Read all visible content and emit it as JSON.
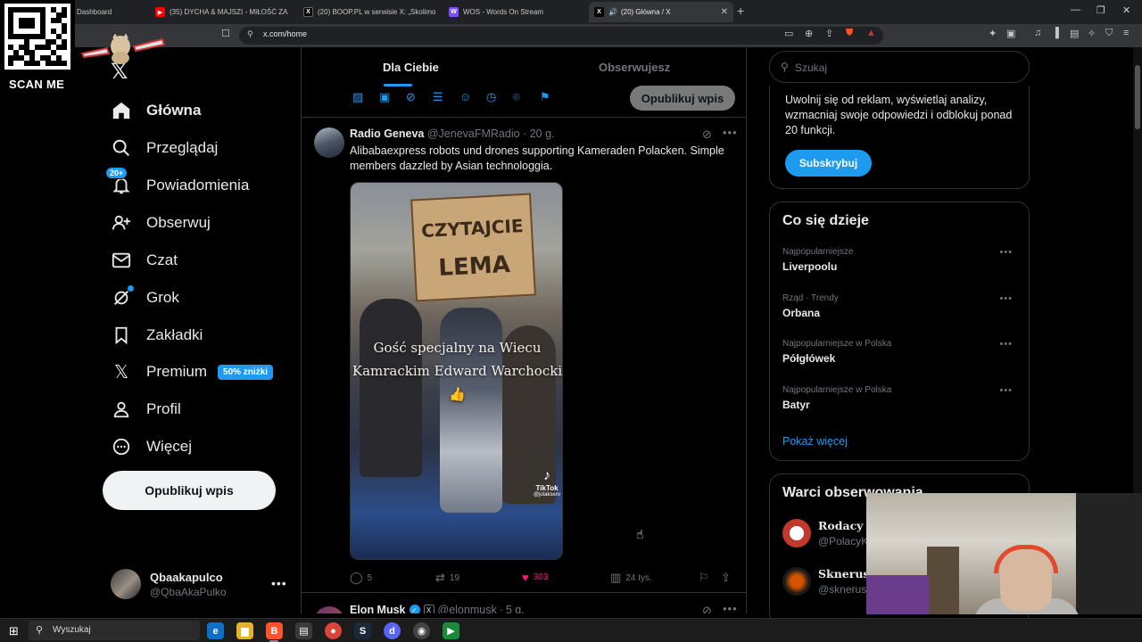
{
  "browser": {
    "tabs": [
      {
        "label": "Dashboard",
        "icon": "dashboard-icon",
        "active": false
      },
      {
        "label": "(35) DYCHA & MAJSZI - MIŁOŚĆ ZA",
        "icon": "youtube-icon",
        "active": false
      },
      {
        "label": "(20) BOOP.PL w serwisie X: „Skolimo",
        "icon": "x-icon",
        "active": false
      },
      {
        "label": "WOS - Words On Stream",
        "icon": "wos-icon",
        "active": false
      },
      {
        "label": "(20) Główna / X",
        "icon": "x-icon",
        "active": true
      }
    ],
    "url": "x.com/home"
  },
  "overlay": {
    "scan_me": "SCAN ME"
  },
  "sidebar": {
    "items": [
      {
        "label": "Główna",
        "icon": "home-icon",
        "active": true
      },
      {
        "label": "Przeglądaj",
        "icon": "search-icon"
      },
      {
        "label": "Powiadomienia",
        "icon": "bell-icon",
        "badge": "20+"
      },
      {
        "label": "Obserwuj",
        "icon": "follow-icon"
      },
      {
        "label": "Czat",
        "icon": "mail-icon"
      },
      {
        "label": "Grok",
        "icon": "grok-icon"
      },
      {
        "label": "Zakładki",
        "icon": "bookmark-icon"
      },
      {
        "label": "Premium",
        "icon": "x-logo-icon",
        "badge": "50% zniżki"
      },
      {
        "label": "Profil",
        "icon": "person-icon"
      },
      {
        "label": "Więcej",
        "icon": "more-circle-icon"
      }
    ],
    "post_button": "Opublikuj wpis",
    "account": {
      "name": "Qbaakapulco",
      "handle": "@QbaAkaPulko"
    }
  },
  "feed": {
    "tabs": {
      "for_you": "Dla Ciebie",
      "following": "Obserwujesz"
    },
    "composer_post": "Opublikuj wpis",
    "tweet": {
      "name": "Radio Geneva",
      "handle": "@JenevaFMRadio",
      "time": "20 g.",
      "text": "Alibabaexpress robots und drones supporting Kameraden Polacken. Simple members dazzled by Asian technologgia.",
      "media": {
        "sign_line1": "CZYTAJCIE",
        "sign_line2": "LEMA",
        "caption": "Gość specjalny na Wiecu Kamrackim Edward Warchocki 👍",
        "tiktok_label": "TikTok",
        "tiktok_user": "@jolaksero"
      },
      "replies": "5",
      "reposts": "19",
      "likes": "303",
      "views": "24 tys."
    },
    "tweet2": {
      "name": "Elon Musk",
      "handle": "@elonmusk",
      "time": "5 g."
    }
  },
  "right": {
    "search_placeholder": "Szukaj",
    "premium_text": "Uwolnij się od reklam, wyświetlaj analizy, wzmacniaj swoje odpowiedzi i odblokuj ponad 20 funkcji.",
    "subscribe": "Subskrybuj",
    "trends_title": "Co się dzieje",
    "trends": [
      {
        "context": "Najpopularniejsze",
        "name": "Liverpoolu"
      },
      {
        "context": "Rząd · Trendy",
        "name": "Orbana"
      },
      {
        "context": "Najpopularniejsze w Polska",
        "name": "Półgłówek"
      },
      {
        "context": "Najpopularniejsze w Polska",
        "name": "Batyr"
      }
    ],
    "show_more": "Pokaż więcej",
    "follow_title": "Warci obserwowania",
    "follow": [
      {
        "name": "Rodacy K",
        "handle": "@PolacyK"
      },
      {
        "name": "Sknerus",
        "handle": "@sknerus"
      }
    ]
  },
  "taskbar": {
    "search": "Wyszukaj"
  },
  "colors": {
    "accent": "#1d9bf0",
    "like": "#f91880",
    "background": "#000000",
    "border": "#2f3336"
  }
}
